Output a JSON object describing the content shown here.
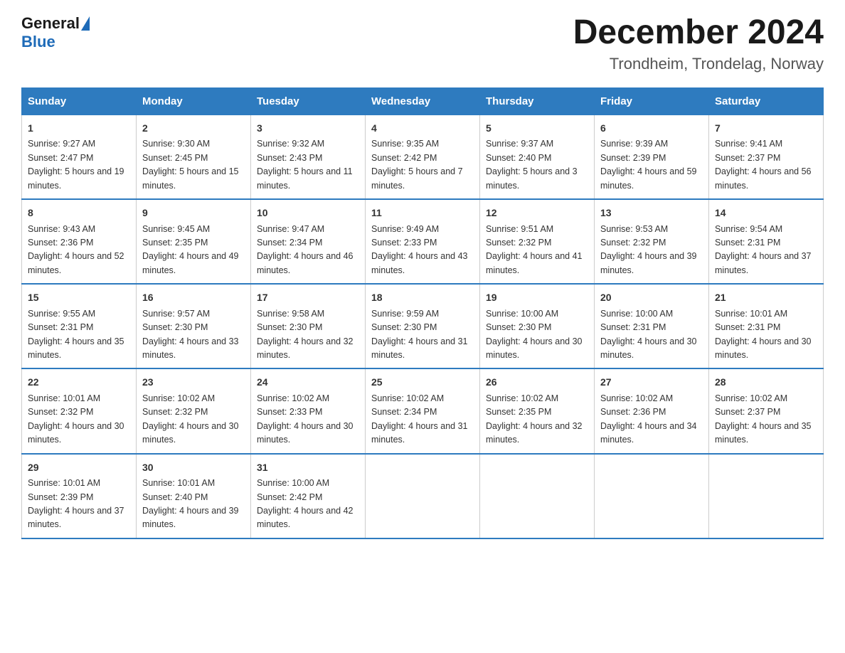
{
  "header": {
    "logo_general": "General",
    "logo_blue": "Blue",
    "month_title": "December 2024",
    "location": "Trondheim, Trondelag, Norway"
  },
  "days_of_week": [
    "Sunday",
    "Monday",
    "Tuesday",
    "Wednesday",
    "Thursday",
    "Friday",
    "Saturday"
  ],
  "weeks": [
    [
      {
        "day": "1",
        "sunrise": "9:27 AM",
        "sunset": "2:47 PM",
        "daylight": "5 hours and 19 minutes."
      },
      {
        "day": "2",
        "sunrise": "9:30 AM",
        "sunset": "2:45 PM",
        "daylight": "5 hours and 15 minutes."
      },
      {
        "day": "3",
        "sunrise": "9:32 AM",
        "sunset": "2:43 PM",
        "daylight": "5 hours and 11 minutes."
      },
      {
        "day": "4",
        "sunrise": "9:35 AM",
        "sunset": "2:42 PM",
        "daylight": "5 hours and 7 minutes."
      },
      {
        "day": "5",
        "sunrise": "9:37 AM",
        "sunset": "2:40 PM",
        "daylight": "5 hours and 3 minutes."
      },
      {
        "day": "6",
        "sunrise": "9:39 AM",
        "sunset": "2:39 PM",
        "daylight": "4 hours and 59 minutes."
      },
      {
        "day": "7",
        "sunrise": "9:41 AM",
        "sunset": "2:37 PM",
        "daylight": "4 hours and 56 minutes."
      }
    ],
    [
      {
        "day": "8",
        "sunrise": "9:43 AM",
        "sunset": "2:36 PM",
        "daylight": "4 hours and 52 minutes."
      },
      {
        "day": "9",
        "sunrise": "9:45 AM",
        "sunset": "2:35 PM",
        "daylight": "4 hours and 49 minutes."
      },
      {
        "day": "10",
        "sunrise": "9:47 AM",
        "sunset": "2:34 PM",
        "daylight": "4 hours and 46 minutes."
      },
      {
        "day": "11",
        "sunrise": "9:49 AM",
        "sunset": "2:33 PM",
        "daylight": "4 hours and 43 minutes."
      },
      {
        "day": "12",
        "sunrise": "9:51 AM",
        "sunset": "2:32 PM",
        "daylight": "4 hours and 41 minutes."
      },
      {
        "day": "13",
        "sunrise": "9:53 AM",
        "sunset": "2:32 PM",
        "daylight": "4 hours and 39 minutes."
      },
      {
        "day": "14",
        "sunrise": "9:54 AM",
        "sunset": "2:31 PM",
        "daylight": "4 hours and 37 minutes."
      }
    ],
    [
      {
        "day": "15",
        "sunrise": "9:55 AM",
        "sunset": "2:31 PM",
        "daylight": "4 hours and 35 minutes."
      },
      {
        "day": "16",
        "sunrise": "9:57 AM",
        "sunset": "2:30 PM",
        "daylight": "4 hours and 33 minutes."
      },
      {
        "day": "17",
        "sunrise": "9:58 AM",
        "sunset": "2:30 PM",
        "daylight": "4 hours and 32 minutes."
      },
      {
        "day": "18",
        "sunrise": "9:59 AM",
        "sunset": "2:30 PM",
        "daylight": "4 hours and 31 minutes."
      },
      {
        "day": "19",
        "sunrise": "10:00 AM",
        "sunset": "2:30 PM",
        "daylight": "4 hours and 30 minutes."
      },
      {
        "day": "20",
        "sunrise": "10:00 AM",
        "sunset": "2:31 PM",
        "daylight": "4 hours and 30 minutes."
      },
      {
        "day": "21",
        "sunrise": "10:01 AM",
        "sunset": "2:31 PM",
        "daylight": "4 hours and 30 minutes."
      }
    ],
    [
      {
        "day": "22",
        "sunrise": "10:01 AM",
        "sunset": "2:32 PM",
        "daylight": "4 hours and 30 minutes."
      },
      {
        "day": "23",
        "sunrise": "10:02 AM",
        "sunset": "2:32 PM",
        "daylight": "4 hours and 30 minutes."
      },
      {
        "day": "24",
        "sunrise": "10:02 AM",
        "sunset": "2:33 PM",
        "daylight": "4 hours and 30 minutes."
      },
      {
        "day": "25",
        "sunrise": "10:02 AM",
        "sunset": "2:34 PM",
        "daylight": "4 hours and 31 minutes."
      },
      {
        "day": "26",
        "sunrise": "10:02 AM",
        "sunset": "2:35 PM",
        "daylight": "4 hours and 32 minutes."
      },
      {
        "day": "27",
        "sunrise": "10:02 AM",
        "sunset": "2:36 PM",
        "daylight": "4 hours and 34 minutes."
      },
      {
        "day": "28",
        "sunrise": "10:02 AM",
        "sunset": "2:37 PM",
        "daylight": "4 hours and 35 minutes."
      }
    ],
    [
      {
        "day": "29",
        "sunrise": "10:01 AM",
        "sunset": "2:39 PM",
        "daylight": "4 hours and 37 minutes."
      },
      {
        "day": "30",
        "sunrise": "10:01 AM",
        "sunset": "2:40 PM",
        "daylight": "4 hours and 39 minutes."
      },
      {
        "day": "31",
        "sunrise": "10:00 AM",
        "sunset": "2:42 PM",
        "daylight": "4 hours and 42 minutes."
      },
      null,
      null,
      null,
      null
    ]
  ],
  "labels": {
    "sunrise": "Sunrise:",
    "sunset": "Sunset:",
    "daylight": "Daylight:"
  }
}
